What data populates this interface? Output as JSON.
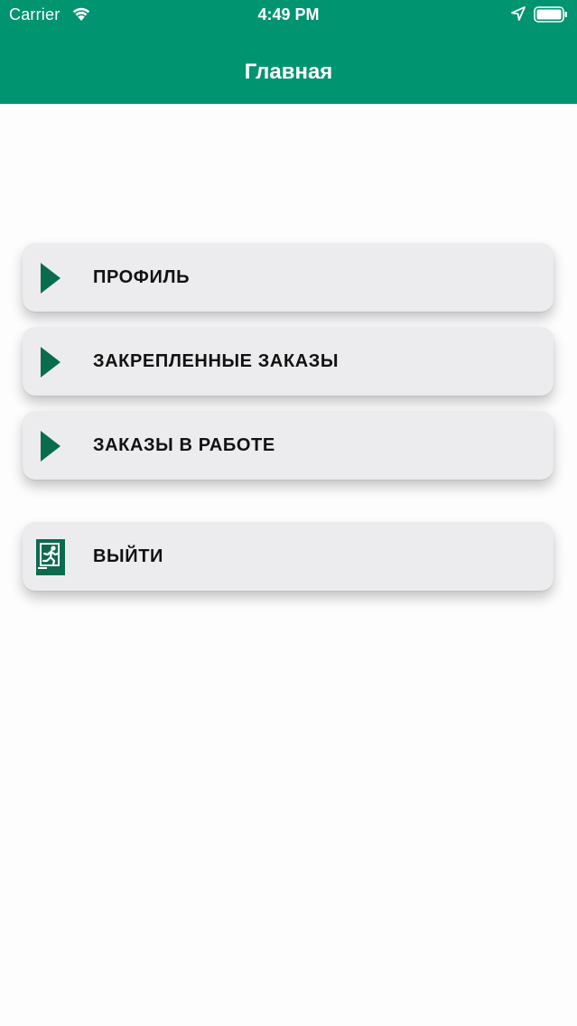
{
  "status_bar": {
    "carrier": "Carrier",
    "time": "4:49 PM",
    "icons": [
      "wifi-icon",
      "location-arrow-icon",
      "battery-icon"
    ]
  },
  "nav": {
    "title": "Главная"
  },
  "menu": {
    "items": [
      {
        "label": "ПРОФИЛЬ",
        "icon": "play-arrow-icon"
      },
      {
        "label": "ЗАКРЕПЛЕННЫЕ ЗАКАЗЫ",
        "icon": "play-arrow-icon"
      },
      {
        "label": "ЗАКАЗЫ В РАБОТЕ",
        "icon": "play-arrow-icon"
      },
      {
        "label": "ВЫЙТИ",
        "icon": "exit-icon"
      }
    ]
  },
  "colors": {
    "header": "#009471",
    "icon": "#0b6b4f",
    "card": "#ececee",
    "text": "#111111"
  }
}
